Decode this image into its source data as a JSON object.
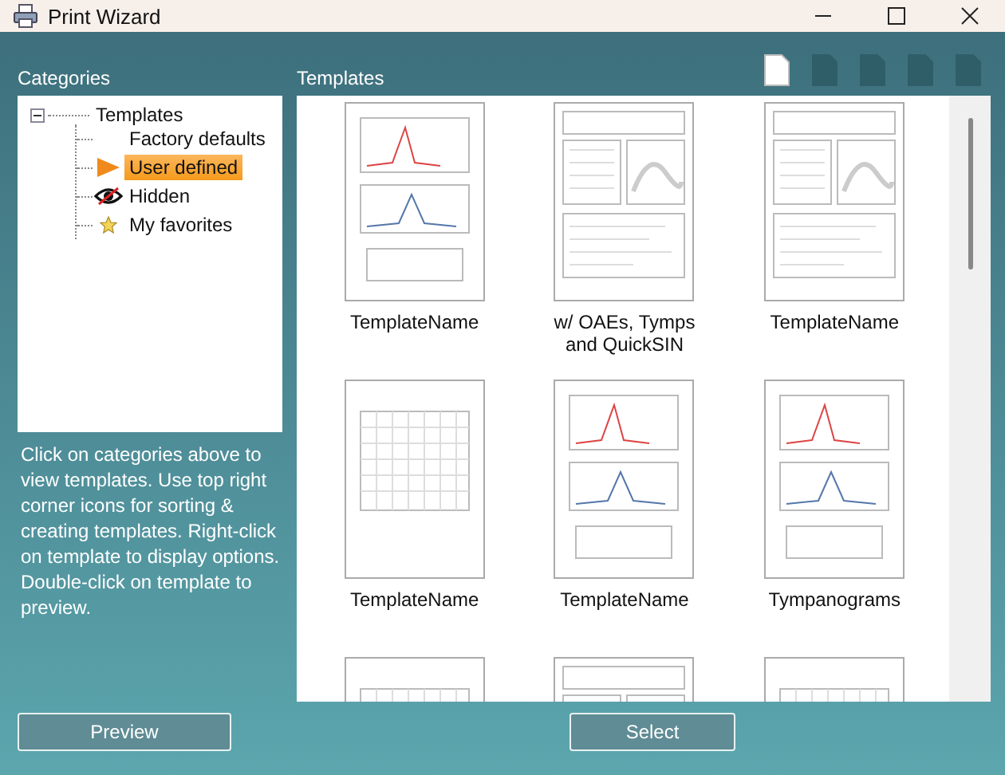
{
  "window": {
    "title": "Print Wizard"
  },
  "categories": {
    "label": "Categories",
    "tree": [
      {
        "label": "Templates",
        "expanded": true,
        "children": [
          {
            "label": "Factory defaults",
            "kind": "none",
            "selected": false
          },
          {
            "label": "User defined",
            "kind": "arrow",
            "selected": true
          },
          {
            "label": "Hidden",
            "kind": "eye",
            "selected": false
          },
          {
            "label": "My favorites",
            "kind": "star",
            "selected": false
          }
        ]
      }
    ]
  },
  "help_text": "Click on categories above to view templates. Use top right corner icons for sorting & creating templates. Right-click on template to display options. Double-click on template to preview.",
  "toolbar": [
    {
      "enabled": true
    },
    {
      "enabled": false
    },
    {
      "enabled": false
    },
    {
      "enabled": false
    },
    {
      "enabled": false
    }
  ],
  "templates": {
    "label": "Templates",
    "items": [
      {
        "kind": "charts",
        "name": "TemplateName"
      },
      {
        "kind": "report",
        "name": "w/ OAEs, Tymps and QuickSIN"
      },
      {
        "kind": "report",
        "name": "TemplateName"
      },
      {
        "kind": "grid",
        "name": "TemplateName"
      },
      {
        "kind": "charts",
        "name": "TemplateName"
      },
      {
        "kind": "charts",
        "name": "Tympanograms"
      },
      {
        "kind": "grid"
      },
      {
        "kind": "report"
      },
      {
        "kind": "grid"
      }
    ]
  },
  "buttons": [
    {
      "label": "Preview"
    },
    {
      "label": "Select"
    }
  ]
}
